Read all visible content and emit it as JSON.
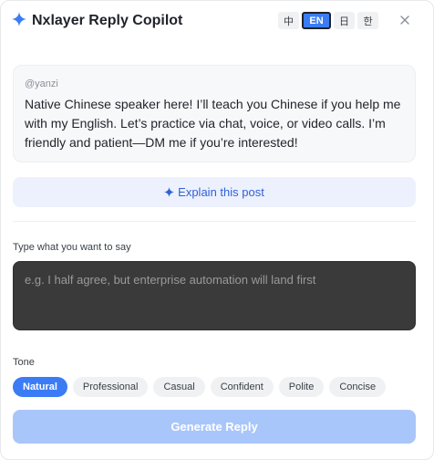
{
  "header": {
    "title": "Nxlayer Reply Copilot",
    "logo_icon": "sparkle-star-icon",
    "languages": [
      {
        "label": "中",
        "active": false
      },
      {
        "label": "EN",
        "active": true
      },
      {
        "label": "日",
        "active": false
      },
      {
        "label": "한",
        "active": false
      }
    ],
    "close_icon": "close-icon"
  },
  "post": {
    "handle": "@yanzi",
    "text": "Native Chinese speaker here! I’ll teach you Chinese if you help me with my English. Let’s practice via chat, voice, or video calls. I’m friendly and patient—DM me if you’re interested!"
  },
  "explain_button": {
    "icon": "sparkle-star-icon",
    "label": "Explain this post"
  },
  "reply_input": {
    "label": "Type what you want to say",
    "value": "",
    "placeholder": "e.g. I half agree, but enterprise automation will land first"
  },
  "tone": {
    "label": "Tone",
    "options": [
      {
        "label": "Natural",
        "selected": true
      },
      {
        "label": "Professional",
        "selected": false
      },
      {
        "label": "Casual",
        "selected": false
      },
      {
        "label": "Confident",
        "selected": false
      },
      {
        "label": "Polite",
        "selected": false
      },
      {
        "label": "Concise",
        "selected": false
      }
    ]
  },
  "generate_button": {
    "label": "Generate Reply",
    "enabled": false
  },
  "colors": {
    "accent": "#3b7cf6",
    "explain_bg": "#edf1fd",
    "explain_text": "#2f62d6",
    "input_bg": "#3a3a3a",
    "generate_disabled": "#a9c6fa"
  }
}
